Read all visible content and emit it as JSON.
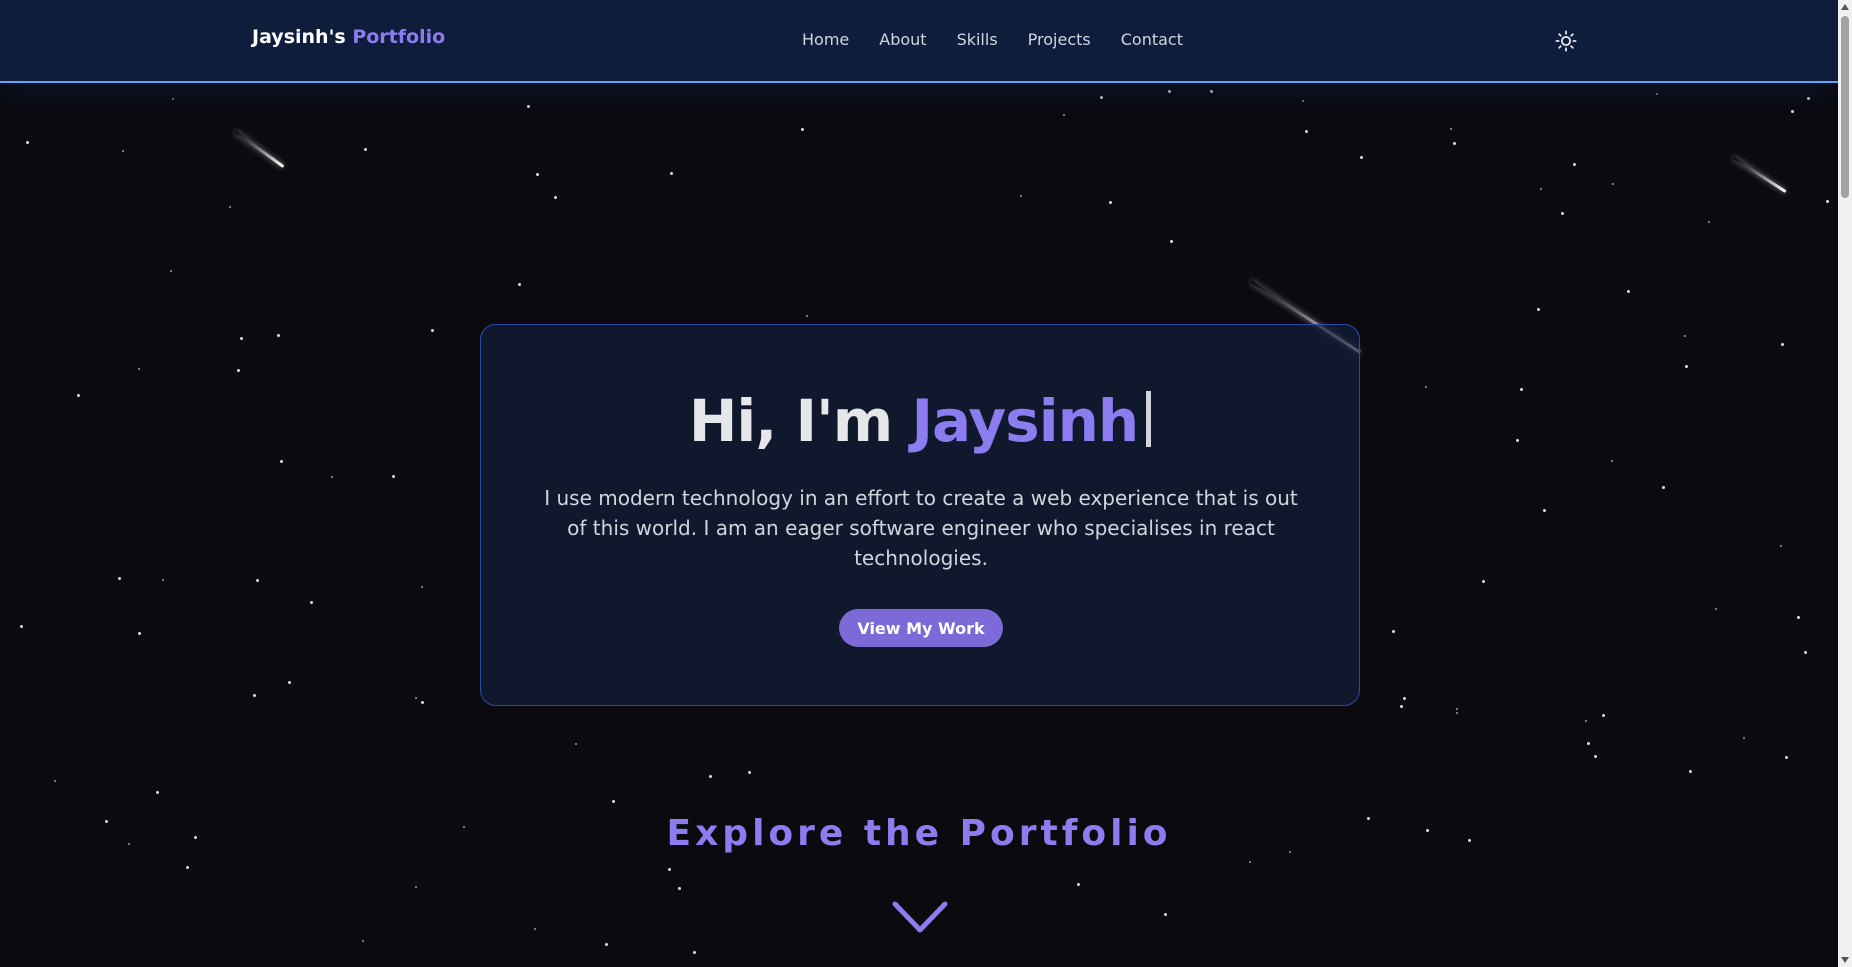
{
  "navbar": {
    "brand_name": "Jaysinh's",
    "brand_accent": "Portfolio",
    "links": [
      "Home",
      "About",
      "Skills",
      "Projects",
      "Contact"
    ],
    "theme_toggle_icon": "sun-icon"
  },
  "hero": {
    "greeting": "Hi, I'm",
    "name": "Jaysinh",
    "description": "I use modern technology in an effort to create a web experience that is out of this world. I am an eager software engineer who specialises in react technologies.",
    "cta_label": "View My Work"
  },
  "explore": {
    "label": "Explore the Portfolio",
    "icon": "chevron-down-icon"
  },
  "colors": {
    "background": "#0a0a0f",
    "navbar": "#0f1d3d",
    "accent": "#8b7cf0",
    "button": "#7c6ad8",
    "card_border": "#2f4bb0"
  }
}
